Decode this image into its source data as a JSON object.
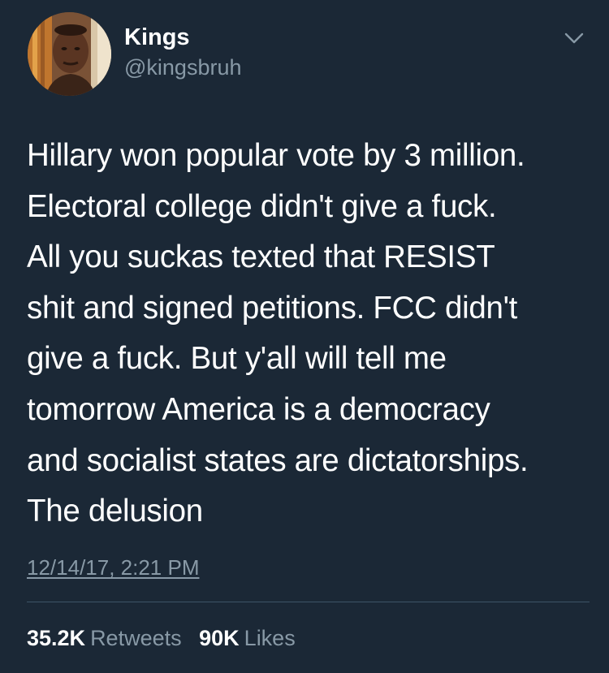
{
  "author": {
    "display_name": "Kings",
    "handle": "@kingsbruh"
  },
  "menu": {
    "icon": "chevron-down-icon"
  },
  "tweet": {
    "lines": [
      "Hillary won popular vote by 3 million.",
      "Electoral college didn't give a fuck.",
      "All you suckas texted that RESIST",
      "shit and signed petitions. FCC didn't",
      "give a fuck. But y'all will tell me",
      "tomorrow America is a democracy",
      "and socialist states are dictatorships.",
      "The delusion"
    ],
    "timestamp": "12/14/17, 2:21 PM"
  },
  "stats": {
    "retweets_count": "35.2K",
    "retweets_label": "Retweets",
    "likes_count": "90K",
    "likes_label": "Likes"
  },
  "colors": {
    "background": "#1b2836",
    "primary_text": "#ffffff",
    "secondary_text": "#8899a6",
    "divider": "#3d5466"
  }
}
